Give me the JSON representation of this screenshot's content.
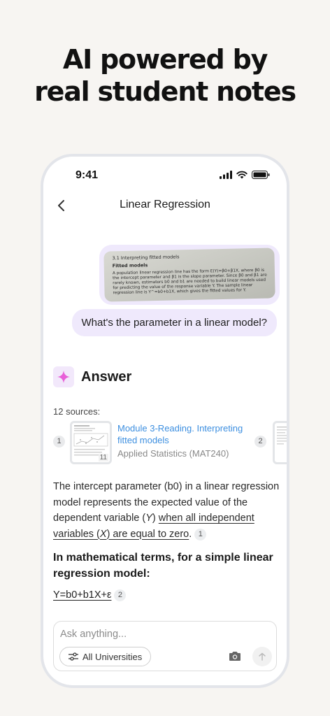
{
  "headline": {
    "line1": "AI powered by",
    "line2": "real student notes"
  },
  "status_bar": {
    "time": "9:41"
  },
  "nav": {
    "title": "Linear Regression"
  },
  "image_message": {
    "section": "3.1 Interpreting fitted models",
    "title": "Fitted models",
    "body": "A population linear regression line has the form E(Y)=β0+β1X, where β0 is the intercept parameter and β1 is the slope parameter. Since β0 and β1 are rarely known, estimators b0 and b1 are needed to build linear models used for predicting the value of the response variable Y. The sample linear regression line is Y^=b0+b1X, which gives the fitted values for Y."
  },
  "question": "What's the parameter in a linear model?",
  "answer": {
    "label": "Answer",
    "sources_label": "12 sources:",
    "source": {
      "index": "1",
      "title": "Module 3-Reading. Interpreting fitted models",
      "course": "Applied Statistics (MAT240)",
      "page_badge": "11"
    },
    "source2_index": "2",
    "paragraph": {
      "part1": "The intercept parameter (b0) in a linear regression model represents the expected value of the dependent variable (",
      "var_y": "Y",
      "part2": ") ",
      "underlined_part1": "when all independent variables (",
      "var_x": "X",
      "underlined_part2": ") are equal to zero",
      "end": ".",
      "cite": "1"
    },
    "subheading": "In mathematical terms, for a simple linear regression model:",
    "formula": "Y=b0+b1X+ε",
    "formula_cite": "2"
  },
  "input": {
    "placeholder": "Ask anything...",
    "filter_label": "All Universities"
  },
  "colors": {
    "accent_purple": "#efe9fc",
    "link_blue": "#3d8fe0",
    "sparkle_pink": "#e85fd8"
  }
}
